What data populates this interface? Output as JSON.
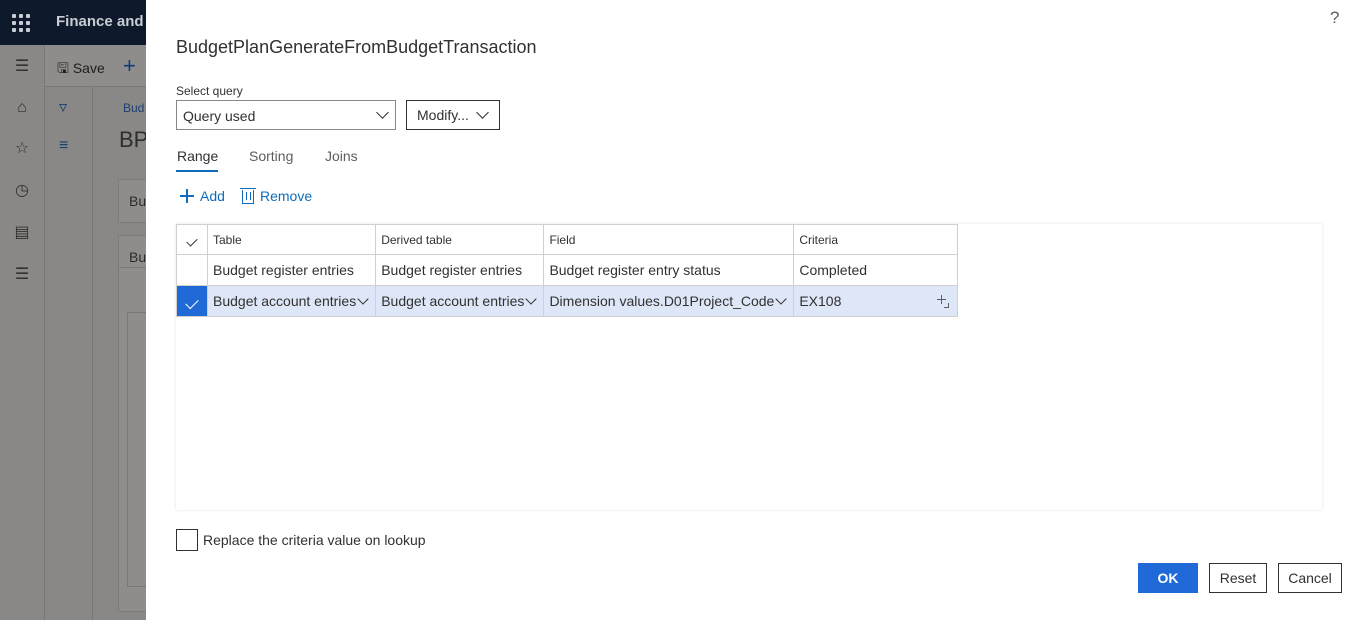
{
  "app": {
    "name": "Finance and",
    "toolbar": {
      "save_label": "Save"
    },
    "breadcrumb": "Bud",
    "page_title": "BP",
    "card1_label": "Bu",
    "card2_label": "Bu"
  },
  "help": {
    "label": "?"
  },
  "dialog": {
    "title": "BudgetPlanGenerateFromBudgetTransaction",
    "select_query": {
      "label": "Select query",
      "value": "Query used"
    },
    "modify_label": "Modify...",
    "tabs": [
      {
        "label": "Range",
        "active": true
      },
      {
        "label": "Sorting",
        "active": false
      },
      {
        "label": "Joins",
        "active": false
      }
    ],
    "actions": {
      "add_label": "Add",
      "remove_label": "Remove"
    },
    "grid": {
      "columns": [
        "Table",
        "Derived table",
        "Field",
        "Criteria"
      ],
      "rows": [
        {
          "table": "Budget register entries",
          "derived_table": "Budget register entries",
          "field": "Budget register entry status",
          "criteria": "Completed",
          "selected": false
        },
        {
          "table": "Budget account entries",
          "derived_table": "Budget account entries",
          "field": "Dimension values.D01Project_Code",
          "criteria": "EX108",
          "selected": true
        }
      ]
    },
    "replace_checkbox": {
      "label": "Replace the criteria value on lookup",
      "checked": false
    },
    "buttons": {
      "ok": "OK",
      "reset": "Reset",
      "cancel": "Cancel"
    }
  },
  "colors": {
    "accent": "#1f6ad6",
    "link": "#0f6cbd",
    "selected_row": "#dde7f7",
    "overlay": "#8a8886"
  }
}
